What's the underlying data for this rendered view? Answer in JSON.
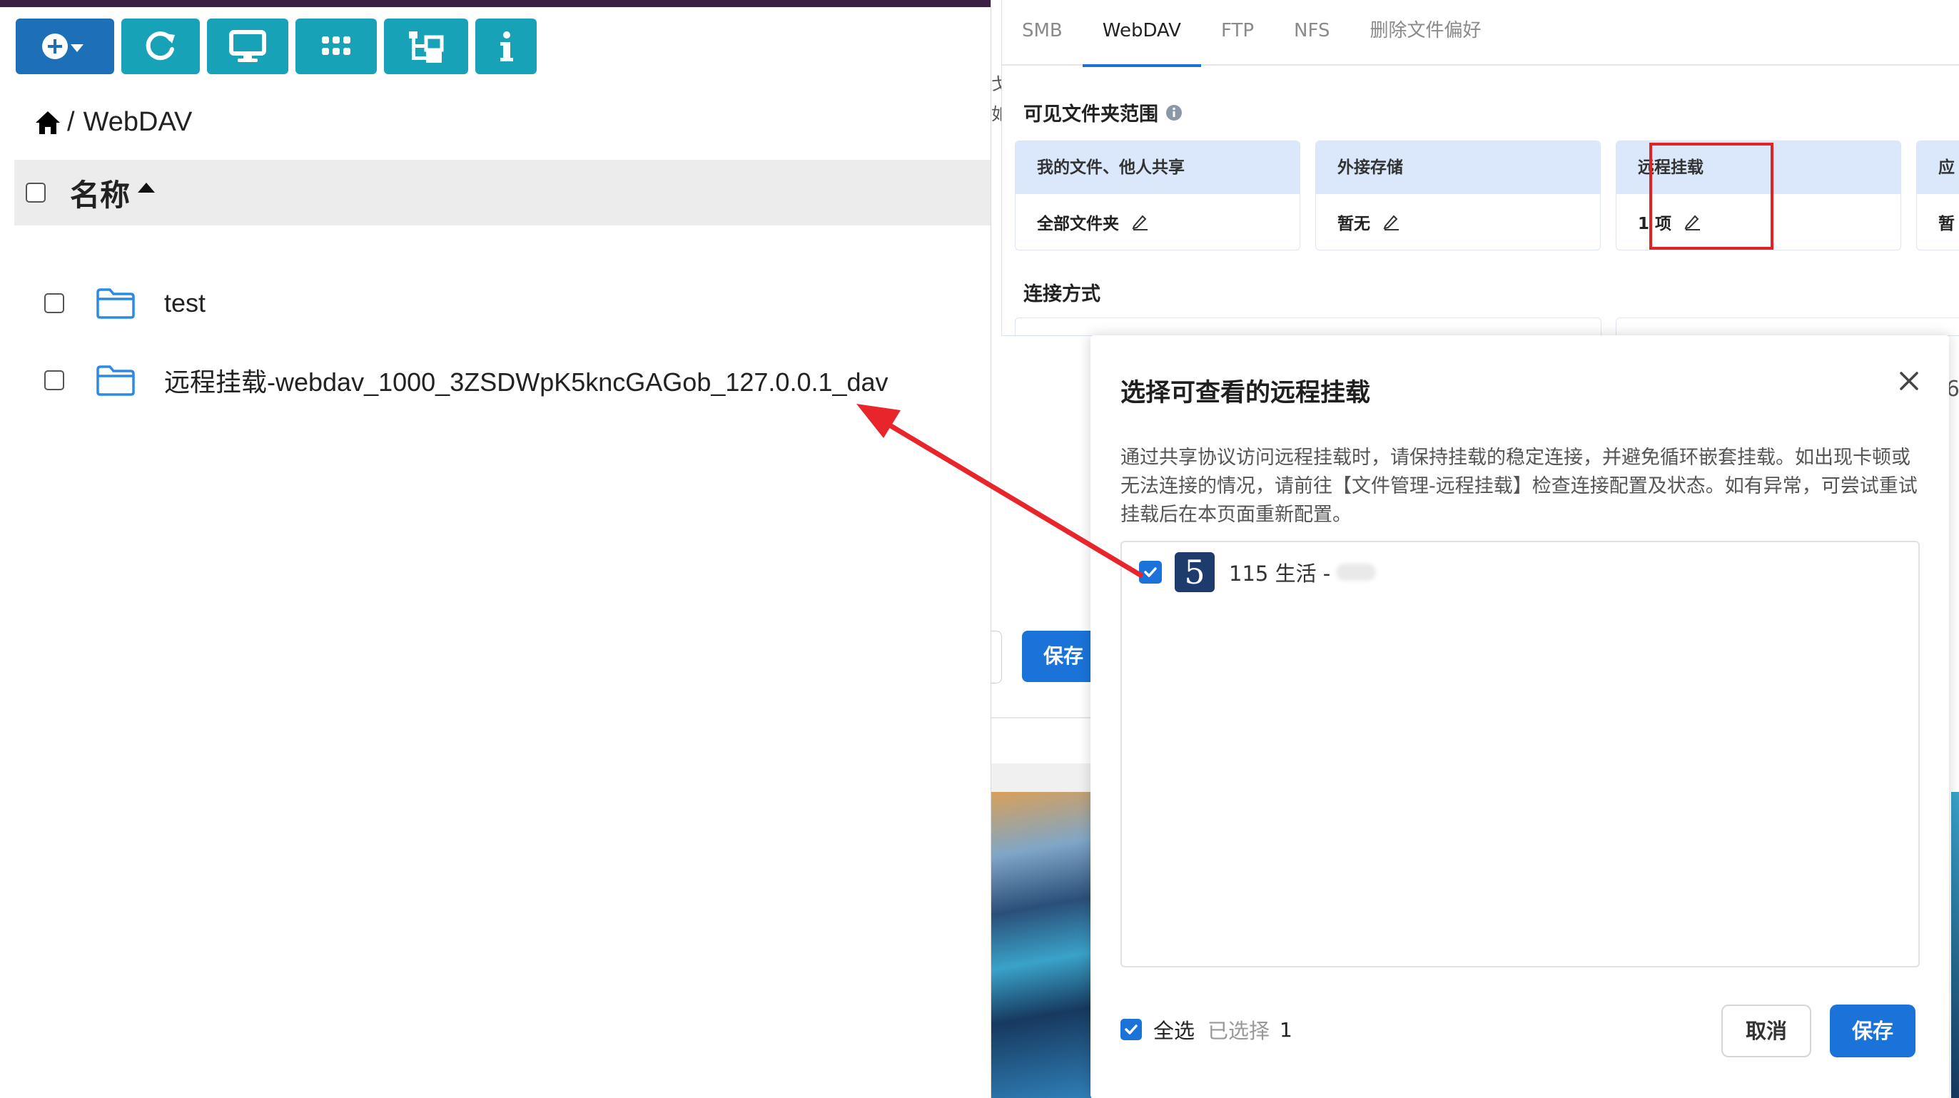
{
  "file_browser": {
    "toolbar": [
      {
        "icon": "add-dropdown-icon"
      },
      {
        "icon": "refresh-icon"
      },
      {
        "icon": "monitor-icon"
      },
      {
        "icon": "grid-icon"
      },
      {
        "icon": "tree-icon"
      },
      {
        "icon": "info-icon"
      }
    ],
    "breadcrumb": {
      "separator": "/",
      "current": "WebDAV"
    },
    "column_name": "名称",
    "rows": [
      {
        "name": "test"
      },
      {
        "name": "远程挂载-webdav_1000_3ZSDWpK5kncGAGob_127.0.0.1_dav"
      }
    ]
  },
  "settings": {
    "tabs": [
      "SMB",
      "WebDAV",
      "FTP",
      "NFS",
      "删除文件偏好"
    ],
    "active_tab": "WebDAV",
    "scope_title": "可见文件夹范围",
    "cards": [
      {
        "head": "我的文件、他人共享",
        "value": "全部文件夹"
      },
      {
        "head": "外接存储",
        "value": "暂无"
      },
      {
        "head": "远程挂载",
        "value": "1 项"
      },
      {
        "head": "应",
        "value": "暂"
      }
    ],
    "connection_title": "连接方式",
    "bg_save": "保存",
    "peek_left": [
      "戈",
      "如"
    ],
    "peek_right": "6"
  },
  "modal": {
    "title": "选择可查看的远程挂载",
    "description": "通过共享协议访问远程挂载时，请保持挂载的稳定连接，并避免循环嵌套挂载。如出现卡顿或无法连接的情况，请前往【文件管理-远程挂载】检查连接配置及状态。如有异常，可尝试重试挂载后在本页面重新配置。",
    "items": [
      {
        "logo": "5",
        "label": "115 生活 -",
        "checked": true
      }
    ],
    "select_all": "全选",
    "selected_label": "已选择",
    "selected_count": "1",
    "cancel": "取消",
    "save": "保存"
  },
  "colors": {
    "toolbar_teal": "#17a2b8",
    "toolbar_primary": "#1d6fb8",
    "accent_blue": "#1b73d9",
    "highlight_red": "#e02424"
  }
}
